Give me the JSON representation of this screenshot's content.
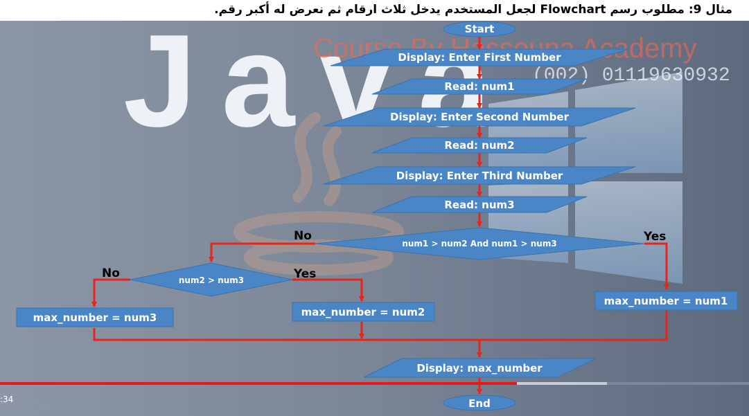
{
  "title": "مثال 9: مطلوب رسم Flowchart لجعل المستخدم يدخل ثلاث ارقام ثم نعرض له أكبر رقم.",
  "watermark": {
    "course": "Course By Hassouna Academy",
    "phone": "(002) 01119630932",
    "logo_text": "Java"
  },
  "flowchart": {
    "start": "Start",
    "display_first": "Display: Enter First Number",
    "read_num1": "Read: num1",
    "display_second": "Display: Enter Second Number",
    "read_num2": "Read: num2",
    "display_third": "Display: Enter Third Number",
    "read_num3": "Read: num3",
    "decision1": "num1 > num2 And num1 > num3",
    "decision1_no": "No",
    "decision1_yes": "Yes",
    "decision2": "num2 >  num3",
    "decision2_no": "No",
    "decision2_yes": "Yes",
    "assign_num3": "max_number = num3",
    "assign_num2": "max_number = num2",
    "assign_num1": "max_number = num1",
    "display_max": "Display: max_number",
    "end": "End"
  },
  "player": {
    "time": ":34",
    "progress_played": 0.69,
    "progress_buffered": 0.81
  },
  "colors": {
    "shape_fill": "#4a86c5",
    "connector": "#e8241b",
    "label_text": "#ffffff",
    "edge_label": "#000000",
    "background": "#7b8698"
  }
}
